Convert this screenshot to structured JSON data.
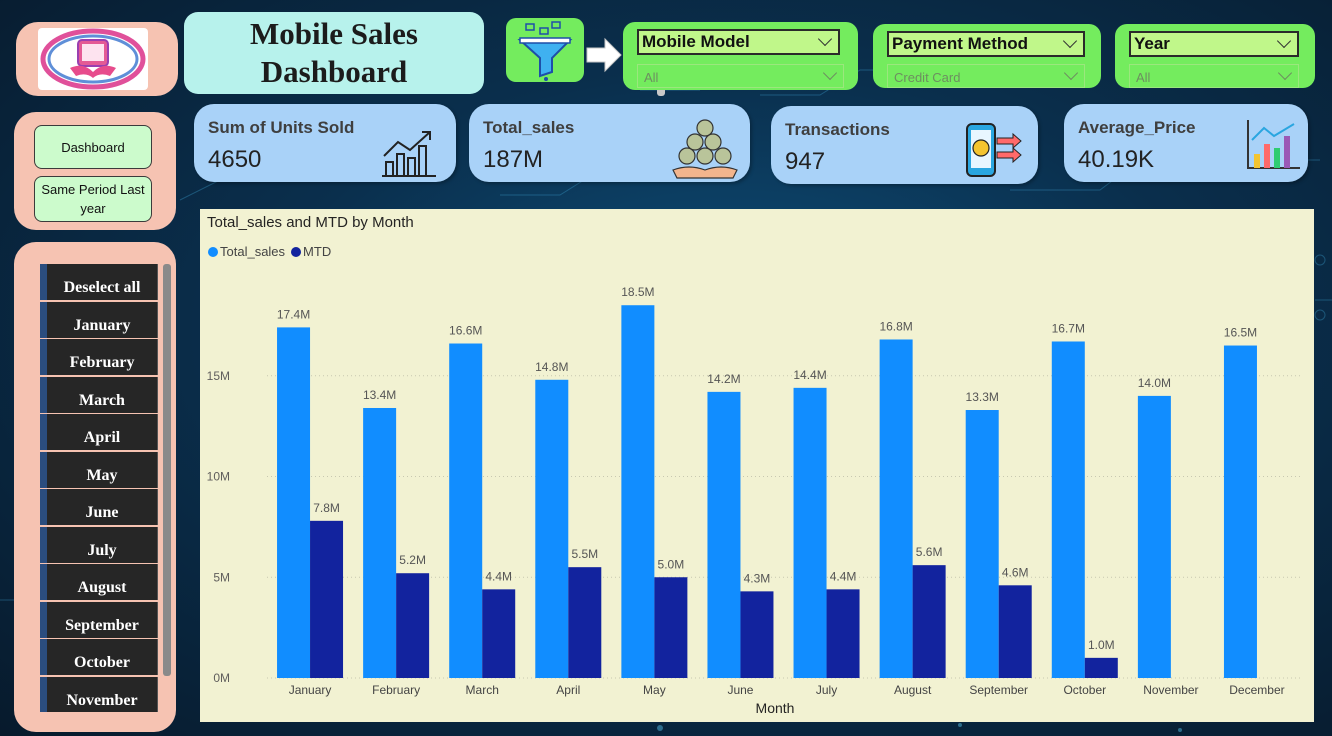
{
  "title": {
    "text": "Mobile Sales\nDashboard"
  },
  "nav": {
    "dashboard": "Dashboard",
    "same_period": "Same Period Last year"
  },
  "slicer": {
    "items": [
      "Deselect all",
      "January",
      "February",
      "March",
      "April",
      "May",
      "June",
      "July",
      "August",
      "September",
      "October",
      "November"
    ]
  },
  "filters": {
    "model": {
      "label": "Mobile Model",
      "value": "All"
    },
    "payment": {
      "label": "Payment Method",
      "value": "Credit Card"
    },
    "year": {
      "label": "Year",
      "value": "All"
    }
  },
  "kpis": {
    "units": {
      "label": "Sum of Units Sold",
      "value": "4650"
    },
    "sales": {
      "label": "Total_sales",
      "value": "187M"
    },
    "transactions": {
      "label": "Transactions",
      "value": "947"
    },
    "avg_price": {
      "label": "Average_Price",
      "value": "40.19K"
    }
  },
  "colors": {
    "total_sales": "#118dff",
    "mtd": "#12239e",
    "kpi_bg": "#a9d2f8",
    "filter_bg": "#74ec5e",
    "chart_bg": "#f2f2d2"
  },
  "chart_data": {
    "type": "bar",
    "title": "Total_sales and MTD by Month",
    "xlabel": "Month",
    "ylabel": "",
    "categories": [
      "January",
      "February",
      "March",
      "April",
      "May",
      "June",
      "July",
      "August",
      "September",
      "October",
      "November",
      "December"
    ],
    "series": [
      {
        "name": "Total_sales",
        "values": [
          17.4,
          13.4,
          16.6,
          14.8,
          18.5,
          14.2,
          14.4,
          16.8,
          13.3,
          16.7,
          14.0,
          16.5
        ],
        "labels": [
          "17.4M",
          "13.4M",
          "16.6M",
          "14.8M",
          "18.5M",
          "14.2M",
          "14.4M",
          "16.8M",
          "13.3M",
          "16.7M",
          "14.0M",
          "16.5M"
        ]
      },
      {
        "name": "MTD",
        "values": [
          7.8,
          5.2,
          4.4,
          5.5,
          5.0,
          4.3,
          4.4,
          5.6,
          4.6,
          1.0,
          null,
          null
        ],
        "labels": [
          "7.8M",
          "5.2M",
          "4.4M",
          "5.5M",
          "5.0M",
          "4.3M",
          "4.4M",
          "5.6M",
          "4.6M",
          "1.0M",
          "",
          ""
        ]
      }
    ],
    "yticks": [
      0,
      5,
      10,
      15
    ],
    "ytick_labels": [
      "0M",
      "5M",
      "10M",
      "15M"
    ],
    "ylim": [
      0,
      20
    ],
    "grid": true,
    "legend": "top-left"
  }
}
